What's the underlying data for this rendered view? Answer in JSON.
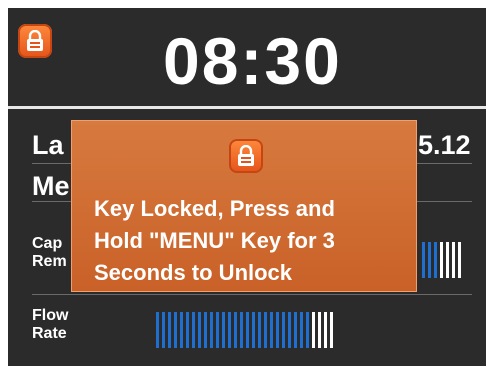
{
  "header": {
    "time": "08:30"
  },
  "rows": {
    "row1_label_partial": "La",
    "row1_value_partial": "5.12",
    "row2_label_partial": "Me",
    "capacity_line1": "Cap",
    "capacity_line2": "Rem",
    "flow_line1": "Flow",
    "flow_line2": "Rate"
  },
  "dialog": {
    "line1": "Key Locked, Press and",
    "line2": "Hold \"MENU\" Key for 3",
    "line3": "Seconds to Unlock"
  },
  "icons": {
    "lock_icon": "padlock-icon",
    "popup_icon": "padlock-icon"
  },
  "colors": {
    "screen_bg": "#2b2b2b",
    "accent_orange": "#e4531a",
    "dialog_bg": "#d0682f",
    "bar_blue": "#1f6fd1"
  },
  "gauges": {
    "capacity_remaining": {
      "blue_bars": 3,
      "white_bars": 4
    },
    "flow_rate": {
      "blue_bars": 26,
      "white_bars": 4
    }
  }
}
